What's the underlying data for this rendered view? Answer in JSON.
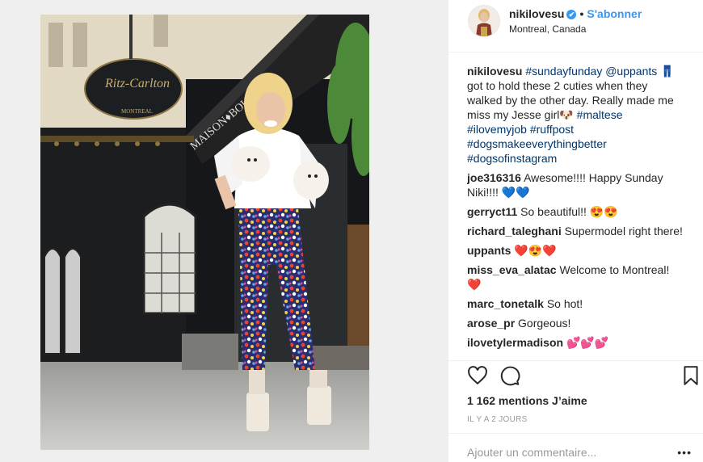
{
  "post": {
    "username": "nikilovesu",
    "verified_badge": "✔",
    "follow_label": "S'abonner",
    "location": "Montreal, Canada",
    "caption": {
      "user": "nikilovesu",
      "text_parts": [
        {
          "text": "#sundayfunday",
          "tag": true
        },
        {
          "text": " ",
          "tag": false
        },
        {
          "text": "@uppants",
          "tag": true
        },
        {
          "text": " 👖 got to hold these 2 cuties when they walked by the other day. Really made me miss my Jesse girl🐶 ",
          "tag": false
        },
        {
          "text": "#maltese",
          "tag": true
        },
        {
          "text": " ",
          "tag": false
        },
        {
          "text": "#ilovemyjob",
          "tag": true
        },
        {
          "text": " ",
          "tag": false
        },
        {
          "text": "#ruffpost",
          "tag": true
        },
        {
          "text": " ",
          "tag": false
        },
        {
          "text": "#dogsmakeeverythingbetter",
          "tag": true
        },
        {
          "text": " ",
          "tag": false
        },
        {
          "text": "#dogsofinstagram",
          "tag": true
        }
      ]
    },
    "comments": [
      {
        "user": "joe316316",
        "text": "Awesome!!!! Happy Sunday Niki!!!! 💙💙"
      },
      {
        "user": "gerryct11",
        "text": "So beautiful!! 😍😍"
      },
      {
        "user": "richard_taleghani",
        "text": "Supermodel right there!"
      },
      {
        "user": "uppants",
        "text": "❤️😍❤️"
      },
      {
        "user": "miss_eva_alatac",
        "text": "Welcome to Montreal! ❤️"
      },
      {
        "user": "marc_tonetalk",
        "text": "So hot!"
      },
      {
        "user": "arose_pr",
        "text": "Gorgeous!"
      },
      {
        "user": "ilovetylermadison",
        "text": "💕💕💕"
      }
    ],
    "likes_label": "1 162 mentions J’aime",
    "time_label": "IL Y A 2 JOURS",
    "add_comment_placeholder": "Ajouter un commentaire...",
    "more_label": "•••"
  },
  "photo": {
    "sign_text": "Ritz-Carlton",
    "sign_subtext": "MONTREAL",
    "awning_text": "MAISON♦BOULUD"
  },
  "icons": {
    "heart": "heart-icon",
    "comment": "comment-icon",
    "bookmark": "bookmark-icon",
    "more": "more-options-icon"
  },
  "colors": {
    "accent_blue": "#3897f0",
    "hashtag": "#003569",
    "heart_red": "#ed4956"
  }
}
